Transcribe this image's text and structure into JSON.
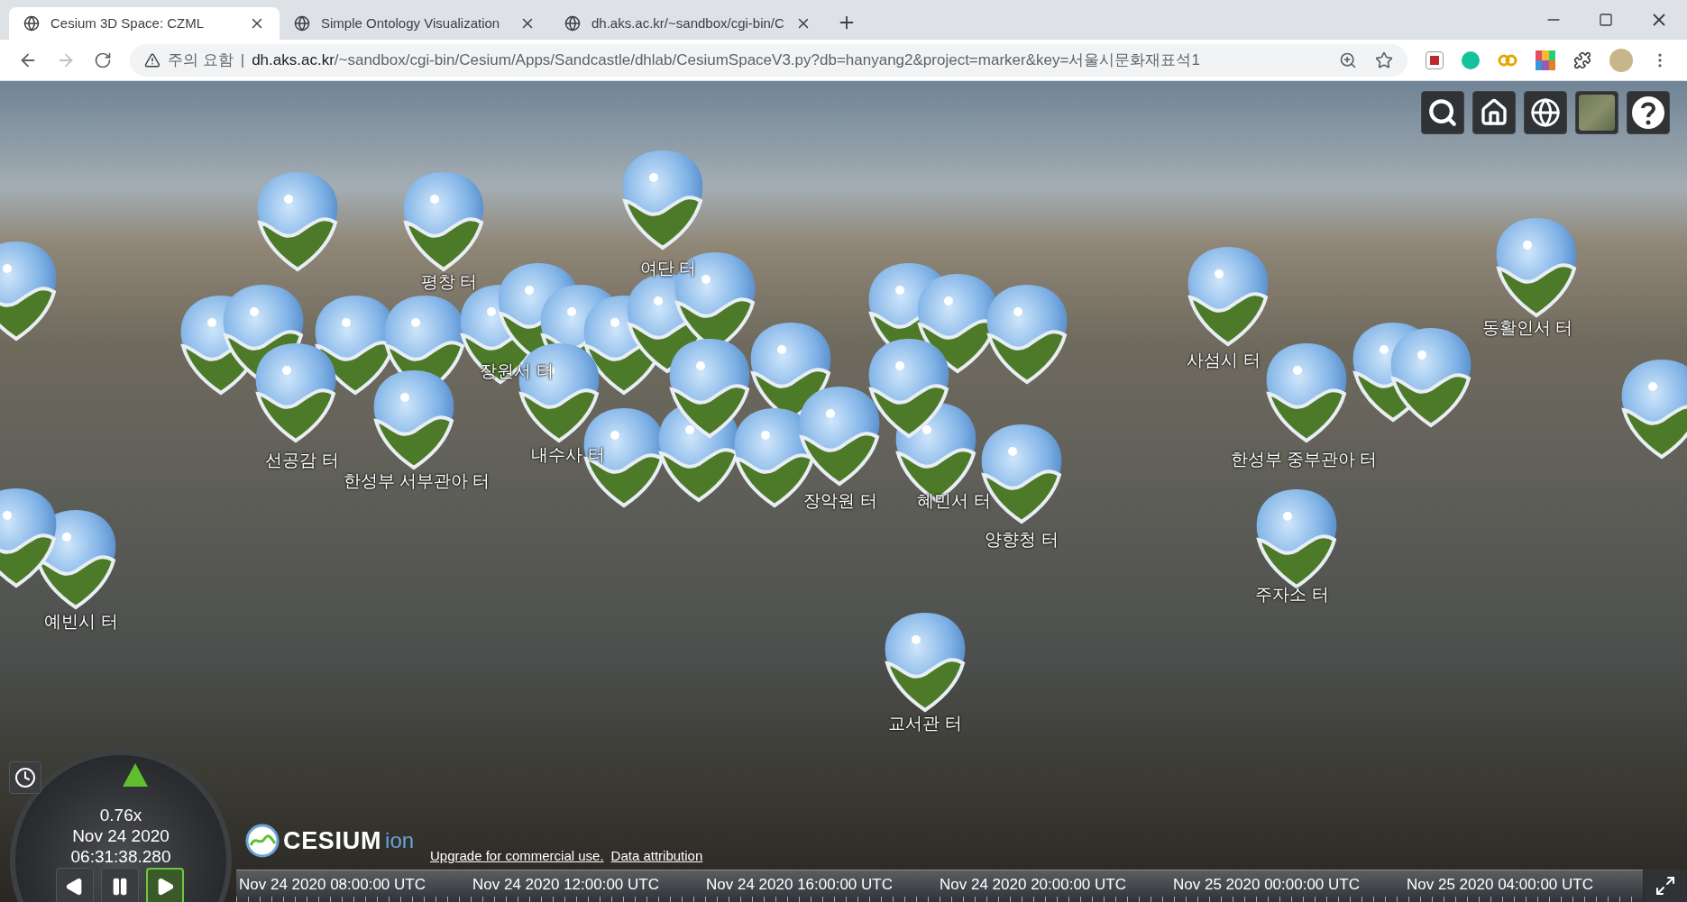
{
  "browser": {
    "tabs": [
      {
        "title": "Cesium 3D Space: CZML",
        "selected": true
      },
      {
        "title": "Simple Ontology Visualization",
        "selected": false
      },
      {
        "title": "dh.aks.ac.kr/~sandbox/cgi-bin/C",
        "selected": false
      }
    ],
    "security_label": "주의 요함",
    "separator": "|",
    "url_host": "dh.aks.ac.kr",
    "url_path": "/~sandbox/cgi-bin/Cesium/Apps/Sandcastle/dhlab/CesiumSpaceV3.py?db=hanyang2&project=marker&key=서울시문화재표석1"
  },
  "markers": [
    {
      "label": "여단 터"
    },
    {
      "label": "평창 터"
    },
    {
      "label": "동활인서 터"
    },
    {
      "label": "사섬시 터"
    },
    {
      "label": "장원서 터"
    },
    {
      "label": "선공감 터"
    },
    {
      "label": "내수사 터"
    },
    {
      "label": "한성부 중부관아 터"
    },
    {
      "label": "한성부 서부관아 터"
    },
    {
      "label": "장악원 터"
    },
    {
      "label": "혜민서 터"
    },
    {
      "label": "양향청 터"
    },
    {
      "label": "주자소 터"
    },
    {
      "label": "예빈시 터"
    },
    {
      "label": "교서관 터"
    }
  ],
  "animation": {
    "speed": "0.76x",
    "date": "Nov 24 2020",
    "time": "06:31:38.280",
    "buttons": [
      {
        "kind": "reverse",
        "selected": false
      },
      {
        "kind": "pause",
        "selected": false
      },
      {
        "kind": "play",
        "selected": true
      }
    ]
  },
  "logo": {
    "name": "CESIUM",
    "suffix": "ion"
  },
  "credits": [
    "Upgrade for commercial use.",
    "Data attribution"
  ],
  "timeline": {
    "ticks": [
      "Nov 24 2020 08:00:00 UTC",
      "Nov 24 2020 12:00:00 UTC",
      "Nov 24 2020 16:00:00 UTC",
      "Nov 24 2020 20:00:00 UTC",
      "Nov 25 2020 00:00:00 UTC",
      "Nov 25 2020 04:00:00 UTC"
    ]
  }
}
